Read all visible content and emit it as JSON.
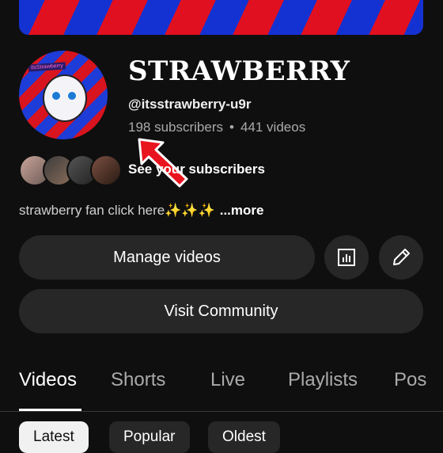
{
  "channel": {
    "name": "STRAWBERRY",
    "handle": "@itsstrawberry-u9r",
    "subscribers": "198 subscribers",
    "separator": "•",
    "videos": "441 videos",
    "avatar_tag": "itsStrawberry"
  },
  "subscribers_link": "See your subscribers",
  "description": {
    "text": "strawberry fan click here✨✨✨",
    "more": "...more"
  },
  "buttons": {
    "manage_videos": "Manage videos",
    "visit_community": "Visit Community",
    "analytics_icon": "analytics-icon",
    "edit_icon": "pencil-icon"
  },
  "tabs": [
    "Videos",
    "Shorts",
    "Live",
    "Playlists",
    "Pos"
  ],
  "active_tab": "Videos",
  "filters": [
    "Latest",
    "Popular",
    "Oldest"
  ],
  "selected_filter": "Latest",
  "colors": {
    "background": "#0f0f0f",
    "button": "#272727",
    "muted_text": "#aaaaaa",
    "annotation_arrow": "#e8141e",
    "banner_blue": "#1432d2",
    "banner_red": "#e01020"
  }
}
